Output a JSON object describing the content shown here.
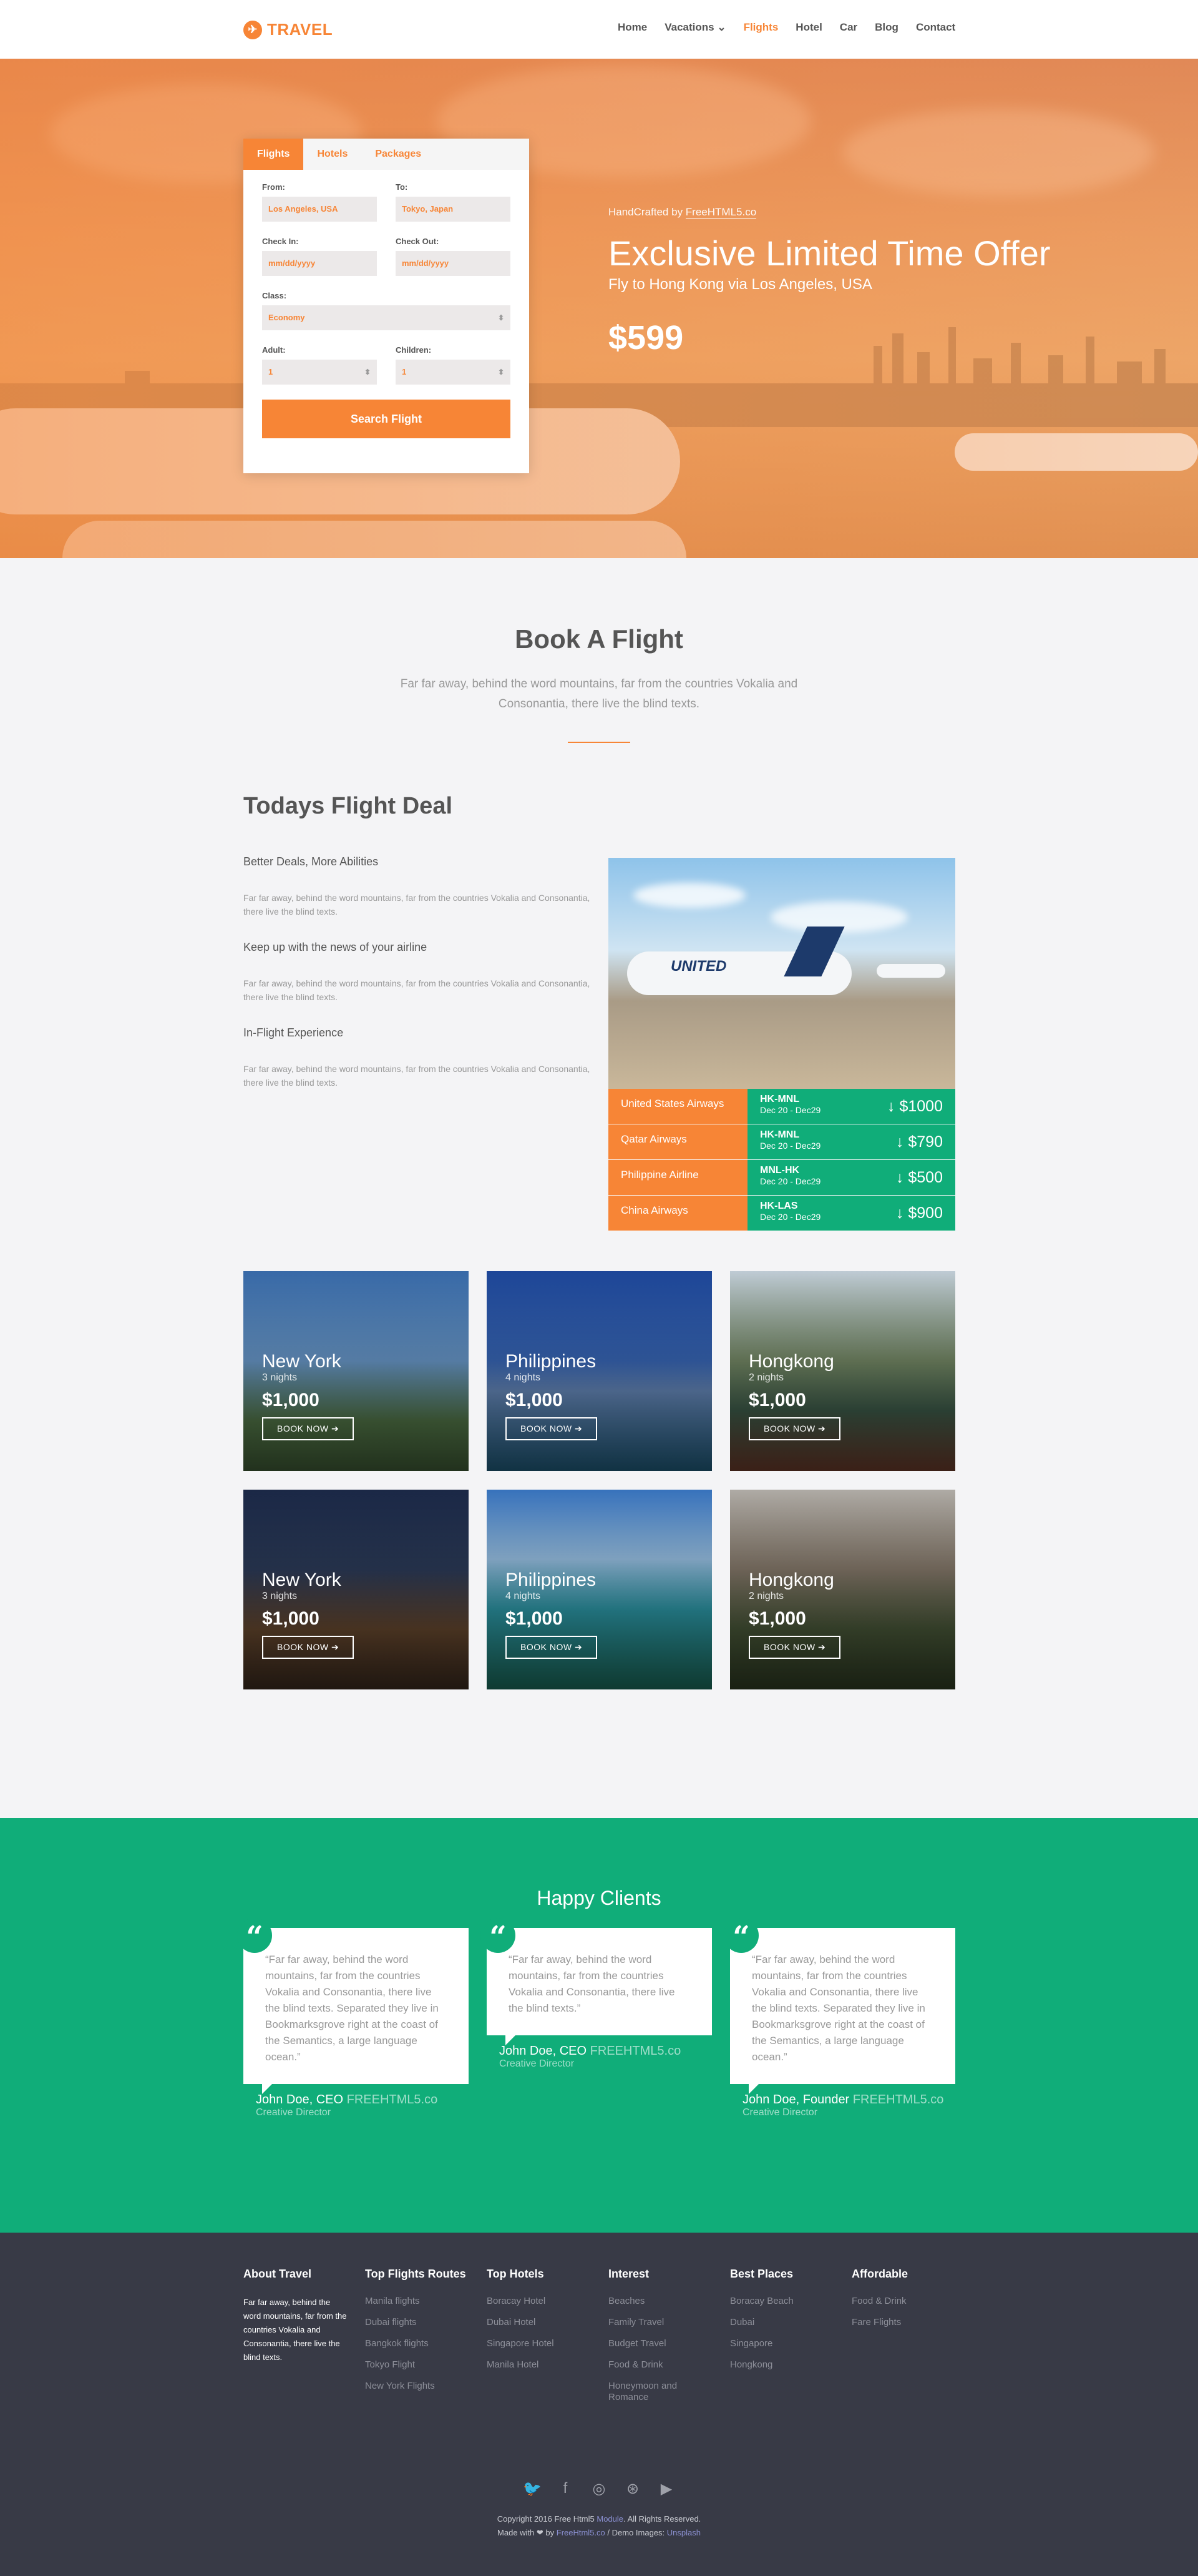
{
  "header": {
    "logo": "TRAVEL",
    "nav": [
      "Home",
      "Vacations ⌄",
      "Flights",
      "Hotel",
      "Car",
      "Blog",
      "Contact"
    ]
  },
  "hero": {
    "tabs": [
      "Flights",
      "Hotels",
      "Packages"
    ],
    "from_label": "From:",
    "from_value": "Los Angeles, USA",
    "to_label": "To:",
    "to_value": "Tokyo, Japan",
    "checkin_label": "Check In:",
    "checkin_value": "mm/dd/yyyy",
    "checkout_label": "Check Out:",
    "checkout_value": "mm/dd/yyyy",
    "class_label": "Class:",
    "class_value": "Economy",
    "adult_label": "Adult:",
    "adult_value": "1",
    "children_label": "Children:",
    "children_value": "1",
    "search_button": "Search Flight",
    "credit_prefix": "HandCrafted by ",
    "credit_link": "FreeHTML5.co",
    "offer_title": "Exclusive Limited Time Offer",
    "offer_sub": "Fly to Hong Kong via Los Angeles, USA",
    "price": "$599"
  },
  "book": {
    "title": "Book A Flight",
    "desc": "Far far away, behind the word mountains, far from the countries Vokalia and Consonantia, there live the blind texts."
  },
  "deal": {
    "title": "Todays Flight Deal",
    "items": [
      {
        "heading": "Better Deals, More Abilities",
        "text": "Far far away, behind the word mountains, far from the countries Vokalia and Consonantia, there live the blind texts."
      },
      {
        "heading": "Keep up with the news of your airline",
        "text": "Far far away, behind the word mountains, far from the countries Vokalia and Consonantia, there live the blind texts."
      },
      {
        "heading": "In-Flight Experience",
        "text": "Far far away, behind the word mountains, far from the countries Vokalia and Consonantia, there live the blind texts."
      }
    ],
    "rows": [
      {
        "airline": "United States Airways",
        "code": "HK-MNL",
        "date": "Dec 20 - Dec29",
        "amount": "$1000"
      },
      {
        "airline": "Qatar Airways",
        "code": "HK-MNL",
        "date": "Dec 20 - Dec29",
        "amount": "$790"
      },
      {
        "airline": "Philippine Airline",
        "code": "MNL-HK",
        "date": "Dec 20 - Dec29",
        "amount": "$500"
      },
      {
        "airline": "China Airways",
        "code": "HK-LAS",
        "date": "Dec 20 - Dec29",
        "amount": "$900"
      }
    ],
    "plane_text": "UNITED"
  },
  "destinations": [
    {
      "city": "New York",
      "nights": "3 nights",
      "price": "$1,000",
      "btn": "BOOK NOW ➔"
    },
    {
      "city": "Philippines",
      "nights": "4 nights",
      "price": "$1,000",
      "btn": "BOOK NOW ➔"
    },
    {
      "city": "Hongkong",
      "nights": "2 nights",
      "price": "$1,000",
      "btn": "BOOK NOW ➔"
    },
    {
      "city": "New York",
      "nights": "3 nights",
      "price": "$1,000",
      "btn": "BOOK NOW ➔"
    },
    {
      "city": "Philippines",
      "nights": "4 nights",
      "price": "$1,000",
      "btn": "BOOK NOW ➔"
    },
    {
      "city": "Hongkong",
      "nights": "2 nights",
      "price": "$1,000",
      "btn": "BOOK NOW ➔"
    }
  ],
  "clients": {
    "title": "Happy Clients",
    "items": [
      {
        "quote": "“Far far away, behind the word mountains, far from the countries Vokalia and Consonantia, there live the blind texts. Separated they live in Bookmarksgrove right at the coast of the Semantics, a large language ocean.”",
        "name": "John Doe, CEO ",
        "company": "FREEHTML5.co",
        "role": "Creative Director"
      },
      {
        "quote": "“Far far away, behind the word mountains, far from the countries Vokalia and Consonantia, there live the blind texts.”",
        "name": "John Doe, CEO ",
        "company": "FREEHTML5.co",
        "role": "Creative Director"
      },
      {
        "quote": "“Far far away, behind the word mountains, far from the countries Vokalia and Consonantia, there live the blind texts. Separated they live in Bookmarksgrove right at the coast of the Semantics, a large language ocean.”",
        "name": "John Doe, Founder ",
        "company": "FREEHTML5.co",
        "role": "Creative Director"
      }
    ]
  },
  "footer": {
    "about_title": "About Travel",
    "about_text": "Far far away, behind the word mountains, far from the countries Vokalia and Consonantia, there live the blind texts.",
    "columns": [
      {
        "title": "Top Flights Routes",
        "items": [
          "Manila flights",
          "Dubai flights",
          "Bangkok flights",
          "Tokyo Flight",
          "New York Flights"
        ]
      },
      {
        "title": "Top Hotels",
        "items": [
          "Boracay Hotel",
          "Dubai Hotel",
          "Singapore Hotel",
          "Manila Hotel"
        ]
      },
      {
        "title": "Interest",
        "items": [
          "Beaches",
          "Family Travel",
          "Budget Travel",
          "Food & Drink",
          "Honeymoon and Romance"
        ]
      },
      {
        "title": "Best Places",
        "items": [
          "Boracay Beach",
          "Dubai",
          "Singapore",
          "Hongkong"
        ]
      },
      {
        "title": "Affordable",
        "items": [
          "Food & Drink",
          "Fare Flights"
        ]
      }
    ],
    "social_icons": [
      "twitter-icon",
      "facebook-icon",
      "instagram-icon",
      "dribbble-icon",
      "youtube-icon"
    ],
    "copy1_prefix": "Copyright 2016 Free Html5 ",
    "copy1_link": "Module",
    "copy1_suffix": ". All Rights Reserved.",
    "copy2_prefix": "Made with ❤ by ",
    "copy2_link": "FreeHtml5.co",
    "copy2_mid": " / Demo Images: ",
    "copy2_link2": "Unsplash"
  },
  "colors": {
    "accent": "#f78536",
    "green": "#10ad79",
    "footer": "#383a46"
  }
}
